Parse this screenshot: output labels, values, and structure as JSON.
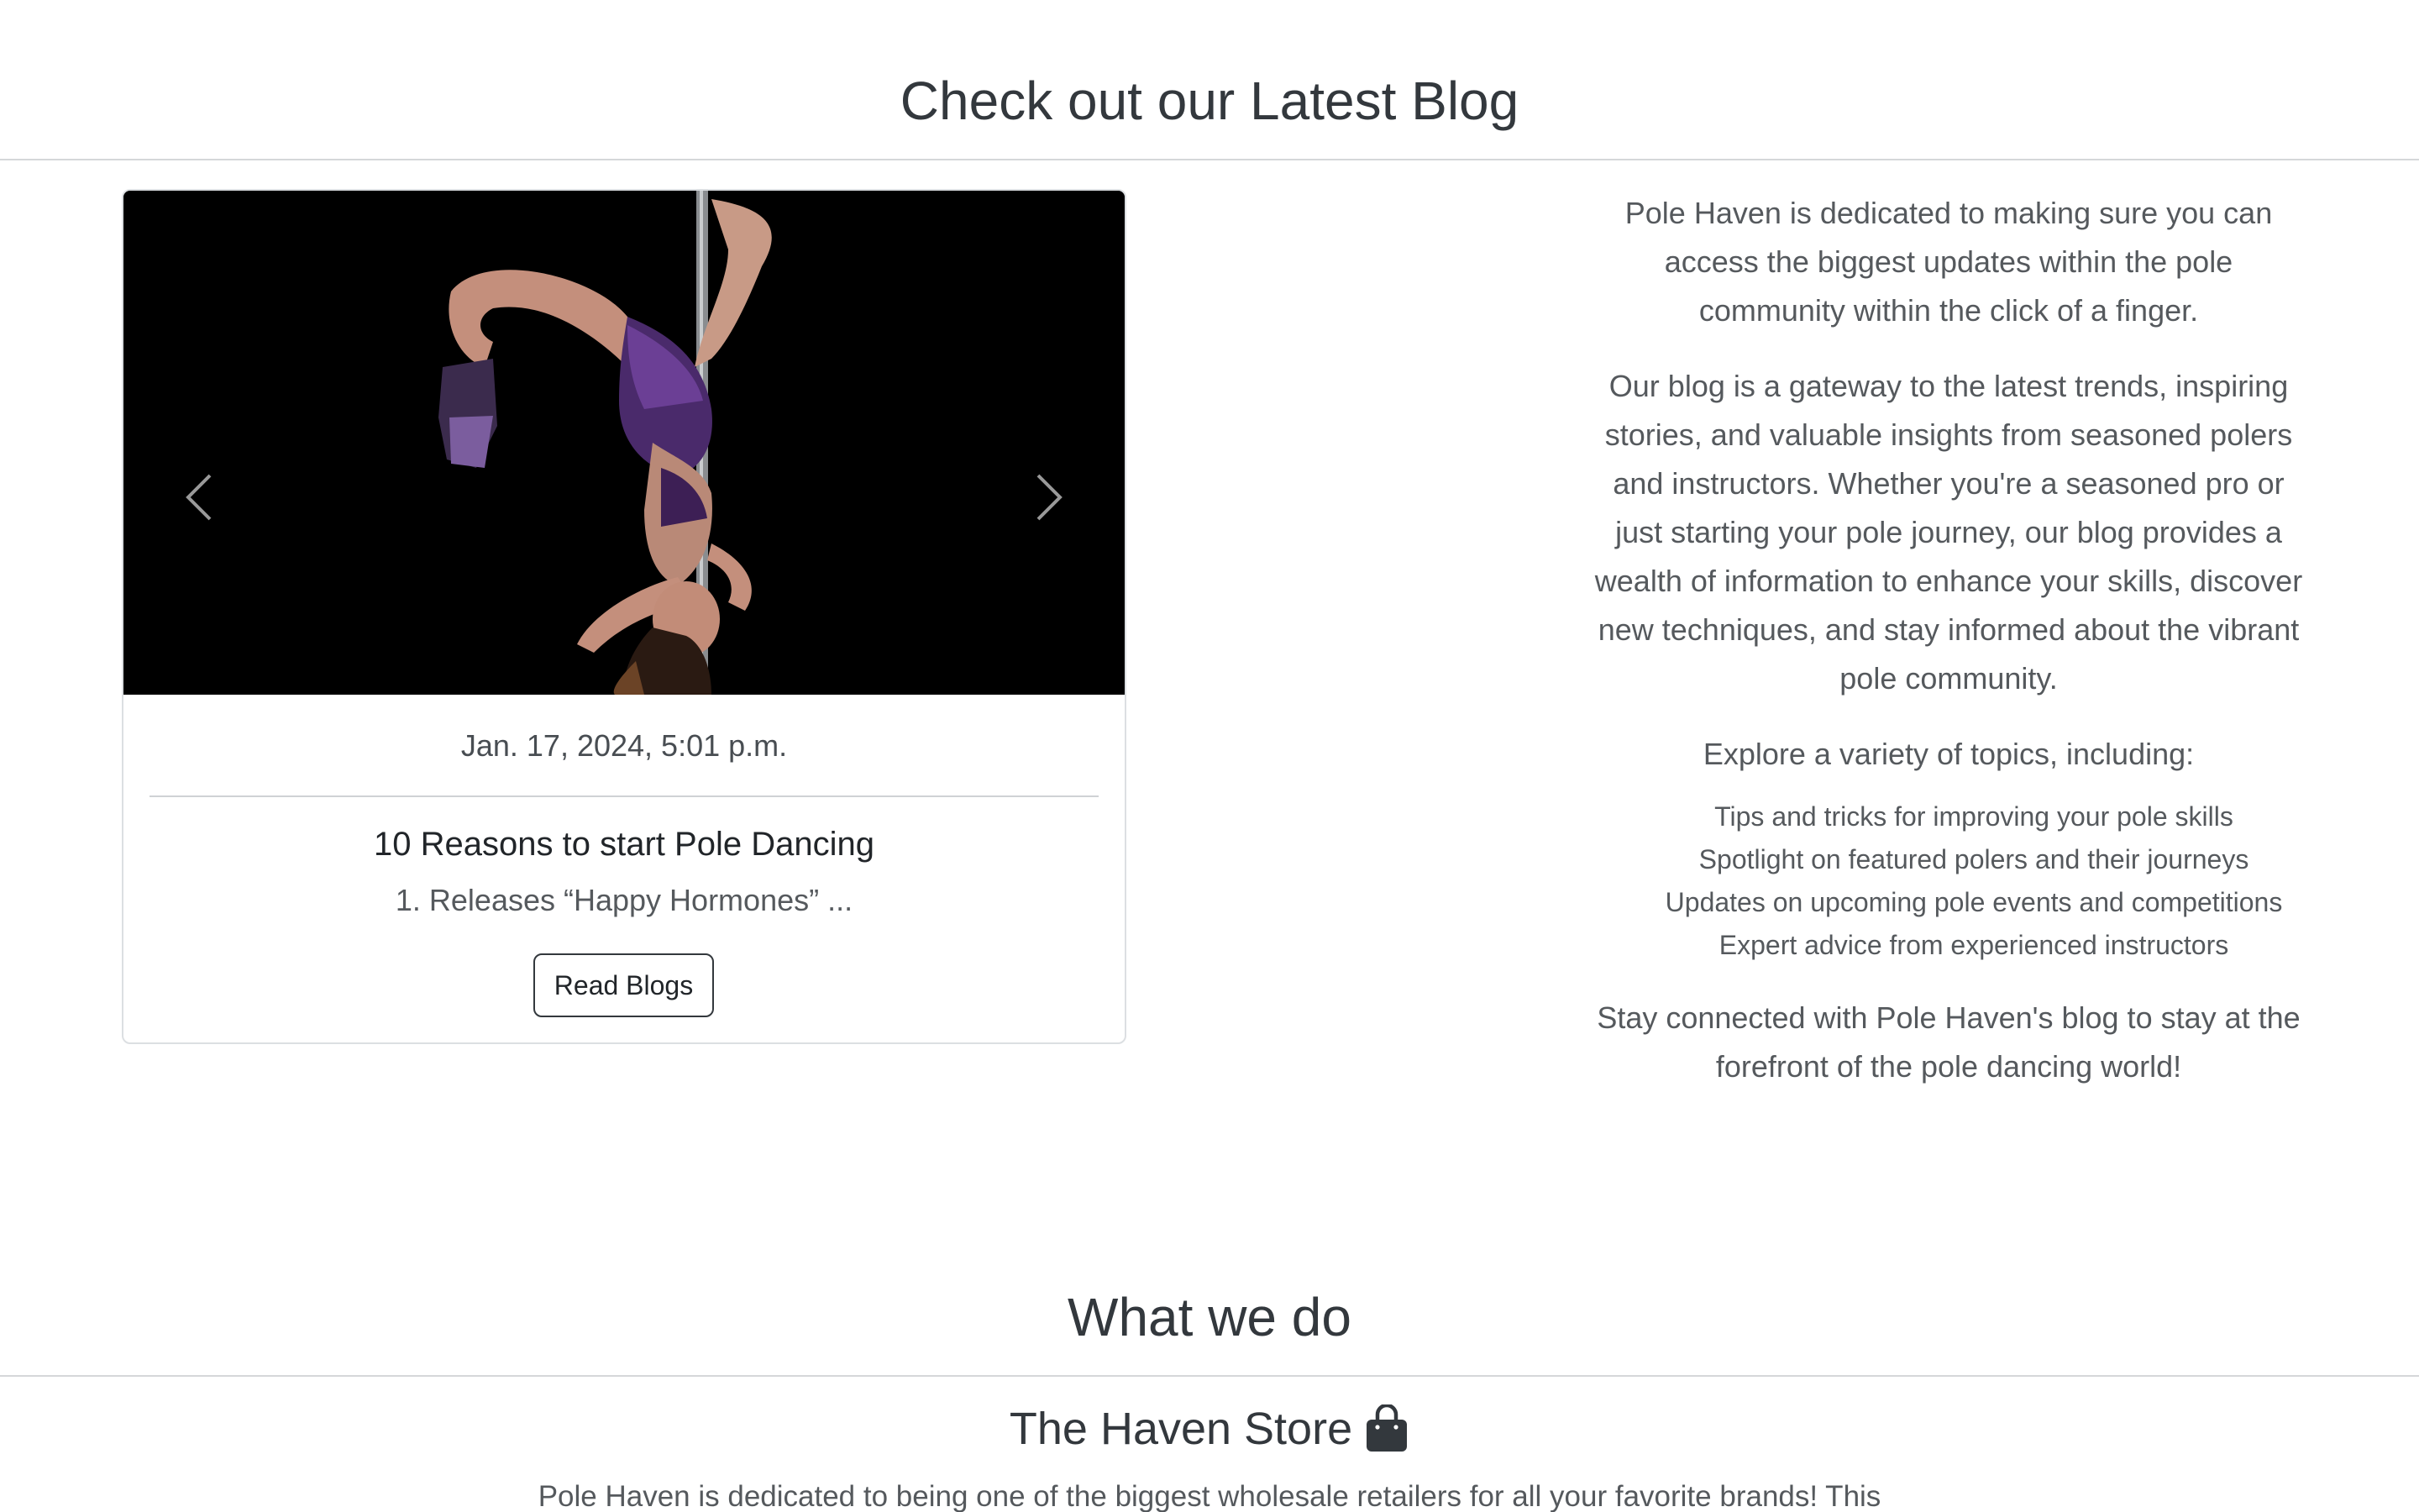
{
  "latest_blog": {
    "heading": "Check out our Latest Blog",
    "card": {
      "image_alt": "Pole dancer performing an inverted pose",
      "prev_icon": "chevron-left-icon",
      "next_icon": "chevron-right-icon",
      "date": "Jan. 17, 2024, 5:01 p.m.",
      "title": "10 Reasons to start Pole Dancing",
      "excerpt": "1. Releases “Happy Hormones” ...",
      "button_label": "Read Blogs"
    },
    "description": {
      "intro": "Pole Haven is dedicated to making sure you can access the biggest updates within the pole community within the click of a finger.",
      "gateway": "Our blog is a gateway to the latest trends, inspiring stories, and valuable insights from seasoned polers and instructors. Whether you're a seasoned pro or just starting your pole journey, our blog provides a wealth of information to enhance your skills, discover new techniques, and stay informed about the vibrant pole community.",
      "topics_intro": "Explore a variety of topics, including:",
      "topics": [
        "Tips and tricks for improving your pole skills",
        "Spotlight on featured polers and their journeys",
        "Updates on upcoming pole events and competitions",
        "Expert advice from experienced instructors"
      ],
      "closing": "Stay connected with Pole Haven's blog to stay at the forefront of the pole dancing world!"
    }
  },
  "what_we_do": {
    "heading": "What we do",
    "store": {
      "title": "The Haven Store",
      "icon": "shopping-bag-icon",
      "description": "Pole Haven is dedicated to being one of the biggest wholesale retailers for all your favorite brands! This"
    }
  },
  "colors": {
    "heading": "#33383d",
    "body_text": "#55595d",
    "divider": "#d5d7d9",
    "carousel_bg": "#000000"
  }
}
